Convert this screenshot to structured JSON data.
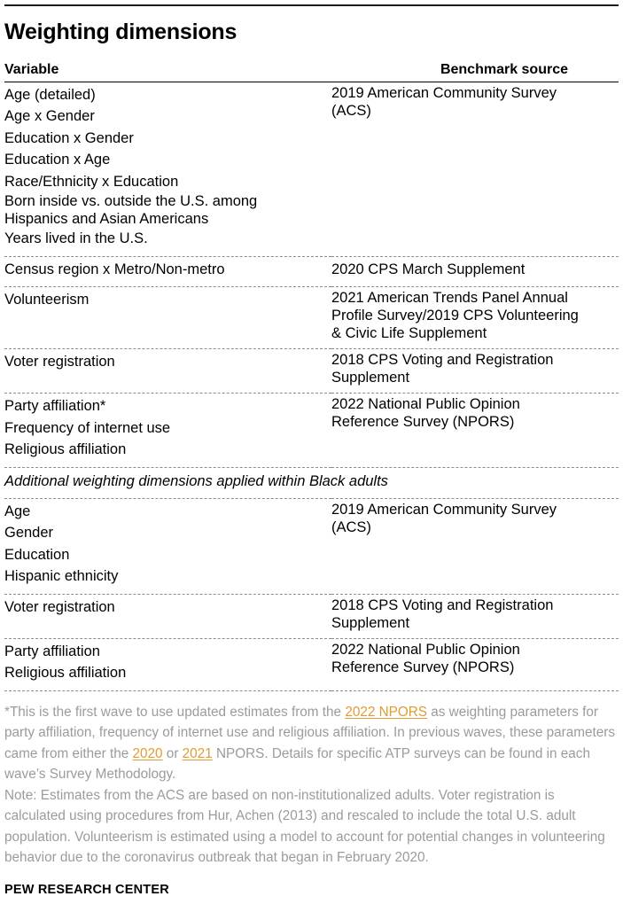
{
  "title": "Weighting dimensions",
  "table": {
    "columns": [
      "Variable",
      "Benchmark source"
    ],
    "groups": [
      {
        "variables": [
          "Age (detailed)",
          "Age x Gender",
          "Education x Gender",
          "Education x Age",
          "Race/Ethnicity x Education",
          "Born inside vs. outside the U.S. among",
          "Hispanics and Asian Americans",
          "Years lived in the U.S."
        ],
        "source": [
          "2019 American Community Survey",
          "(ACS)"
        ]
      },
      {
        "variables": [
          "Census region x Metro/Non-metro"
        ],
        "source": [
          "2020 CPS March Supplement"
        ]
      },
      {
        "variables": [
          "Volunteerism"
        ],
        "source": [
          "2021 American Trends Panel Annual",
          "Profile Survey/2019 CPS Volunteering",
          "& Civic Life Supplement"
        ]
      },
      {
        "variables": [
          "Voter registration"
        ],
        "source": [
          "2018 CPS Voting and Registration",
          "Supplement"
        ]
      },
      {
        "variables": [
          "Party affiliation*",
          "Frequency of internet use",
          "Religious affiliation"
        ],
        "source": [
          "2022 National Public Opinion",
          "Reference Survey (NPORS)"
        ]
      }
    ],
    "subheading": "Additional weighting dimensions applied within Black adults",
    "groups2": [
      {
        "variables": [
          "Age",
          "Gender",
          "Education",
          "Hispanic ethnicity"
        ],
        "source": [
          "2019 American Community Survey",
          "(ACS)"
        ]
      },
      {
        "variables": [
          "Voter registration"
        ],
        "source": [
          "2018 CPS Voting and Registration",
          "Supplement"
        ]
      },
      {
        "variables": [
          "Party affiliation",
          "Religious affiliation"
        ],
        "source": [
          "2022 National Public Opinion",
          "Reference Survey (NPORS)"
        ]
      }
    ]
  },
  "footnote": {
    "part1": "*This is the first wave to use updated estimates from the ",
    "link1": "2022 NPORS",
    "part2": " as weighting parameters for party affiliation, frequency of internet use and religious affiliation. In previous waves, these parameters came from either the ",
    "link2": "2020",
    "part3": " or ",
    "link3": "2021",
    "part4": " NPORS. Details for specific ATP surveys can be found in each wave’s Survey Methodology.",
    "note": "Note: Estimates from the ACS are based on non-institutionalized adults. Voter registration is calculated using procedures from Hur, Achen (2013) and rescaled to include the total U.S. adult population. Volunteerism is estimated using a model to account for potential changes in volunteering behavior due to the coronavirus outbreak that began in February 2020."
  },
  "org": "PEW RESEARCH CENTER",
  "colors": {
    "link": "#e09c30",
    "note_text": "#9b9b9b",
    "rule": "#8c8c8c",
    "text": "#000000"
  }
}
